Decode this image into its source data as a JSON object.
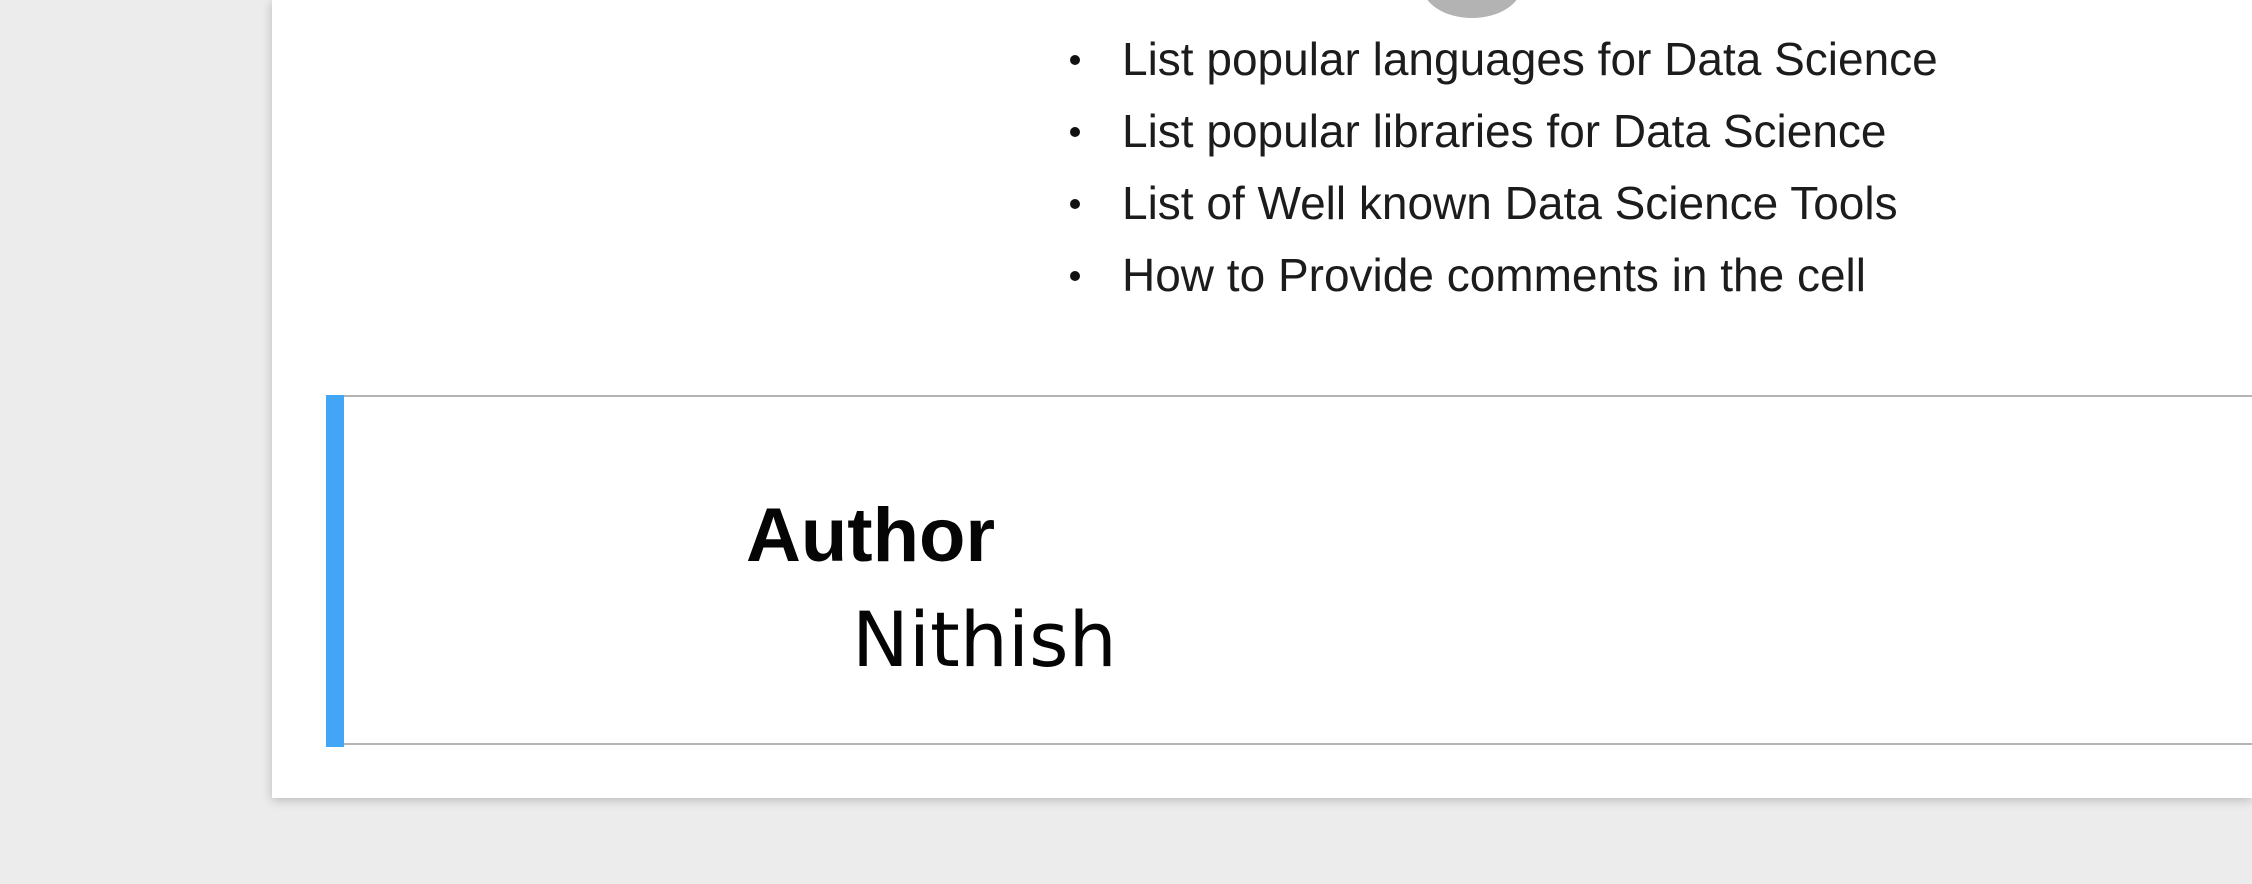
{
  "objectives": [
    "List popular languages for Data Science",
    "List popular libraries for Data Science",
    "List of Well known Data Science Tools",
    "How to Provide comments in the cell"
  ],
  "author_cell": {
    "heading": "Author",
    "name": "Nithish"
  },
  "colors": {
    "cell_accent": "#42a5f5",
    "background": "#ececec",
    "page": "#ffffff"
  }
}
